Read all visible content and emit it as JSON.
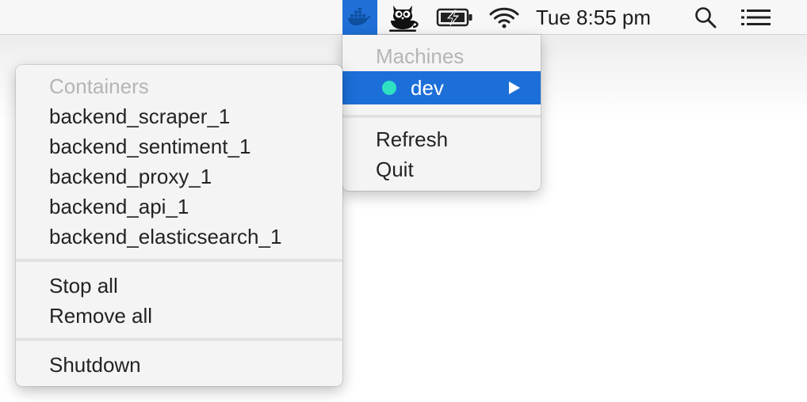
{
  "menubar": {
    "docker_icon": "docker-whale-icon",
    "coffee_icon": "owl-coffee-cup-icon",
    "battery_icon": "battery-charging-icon",
    "wifi_icon": "wifi-icon",
    "clock": "Tue 8:55 pm",
    "search_icon": "search-icon",
    "list_icon": "list-icon",
    "active_color": "#1f6fd6"
  },
  "main_menu": {
    "header": "Machines",
    "machines": [
      {
        "label": "dev",
        "status_color": "#2fe0c2",
        "selected": true
      }
    ],
    "items": [
      "Refresh",
      "Quit"
    ]
  },
  "submenu": {
    "header": "Containers",
    "containers": [
      "backend_scraper_1",
      "backend_sentiment_1",
      "backend_proxy_1",
      "backend_api_1",
      "backend_elasticsearch_1"
    ],
    "actions": [
      "Stop all",
      "Remove all"
    ],
    "final": "Shutdown"
  }
}
